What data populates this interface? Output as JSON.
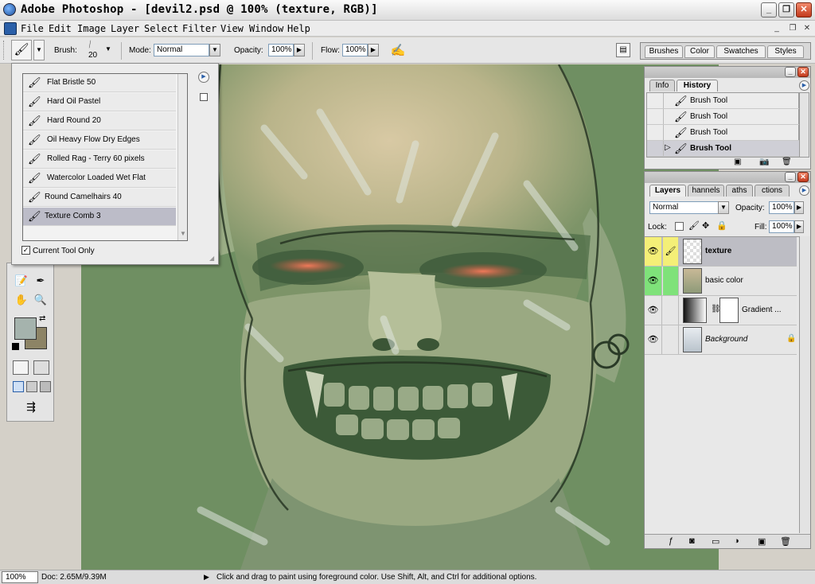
{
  "window": {
    "title": "Adobe Photoshop - [devil2.psd @ 100% (texture, RGB)]",
    "controls": [
      "_",
      "❐",
      "✕"
    ],
    "doc_controls": [
      "_",
      "❐",
      "✕"
    ]
  },
  "menu": [
    "File",
    "Edit",
    "Image",
    "Layer",
    "Select",
    "Filter",
    "View",
    "Window",
    "Help"
  ],
  "options_bar": {
    "brush_label": "Brush:",
    "brush_size": "20",
    "mode_label": "Mode:",
    "mode_value": "Normal",
    "opacity_label": "Opacity:",
    "opacity_value": "100%",
    "flow_label": "Flow:",
    "flow_value": "100%"
  },
  "palette_well_tabs": [
    "Brushes",
    "Color",
    "Swatches",
    "Styles"
  ],
  "brush_picker": {
    "brushes": [
      "Flat Bristle 50",
      "Hard Oil Pastel",
      "Hard Round 20",
      "Oil Heavy Flow Dry Edges",
      "Rolled Rag - Terry 60 pixels",
      "Watercolor Loaded Wet Flat",
      "Round Camelhairs 40",
      "Texture Comb 3"
    ],
    "selected_index": 7,
    "current_tool_only_label": "Current Tool Only",
    "current_tool_only_checked": true
  },
  "history_panel": {
    "tabs": [
      "Info",
      "History"
    ],
    "active_tab": "History",
    "items": [
      "Brush Tool",
      "Brush Tool",
      "Brush Tool",
      "Brush Tool"
    ],
    "current_index": 3
  },
  "layers_panel": {
    "tabs": [
      "Layers",
      "Channels",
      "Paths",
      "Actions"
    ],
    "visible_tab_labels": [
      "Layers",
      "hannels",
      "aths",
      "ctions"
    ],
    "active_tab": "Layers",
    "blend_mode": "Normal",
    "opacity_label": "Opacity:",
    "opacity_value": "100%",
    "lock_label": "Lock:",
    "fill_label": "Fill:",
    "fill_value": "100%",
    "layers": [
      {
        "name": "texture",
        "selected": true
      },
      {
        "name": "basic color",
        "selected": false
      },
      {
        "name": "Gradient ...",
        "selected": false
      },
      {
        "name": "Background",
        "selected": false
      }
    ]
  },
  "status_bar": {
    "zoom": "100%",
    "doc_size": "Doc: 2.65M/9.39M",
    "hint": "Click and drag to paint using foreground color.  Use Shift, Alt, and Ctrl for additional options."
  },
  "colors": {
    "foreground": "#a5b3ad",
    "background": "#8d8466",
    "canvas_green": "#6f8f62",
    "eye_glow": "#e0604a"
  }
}
